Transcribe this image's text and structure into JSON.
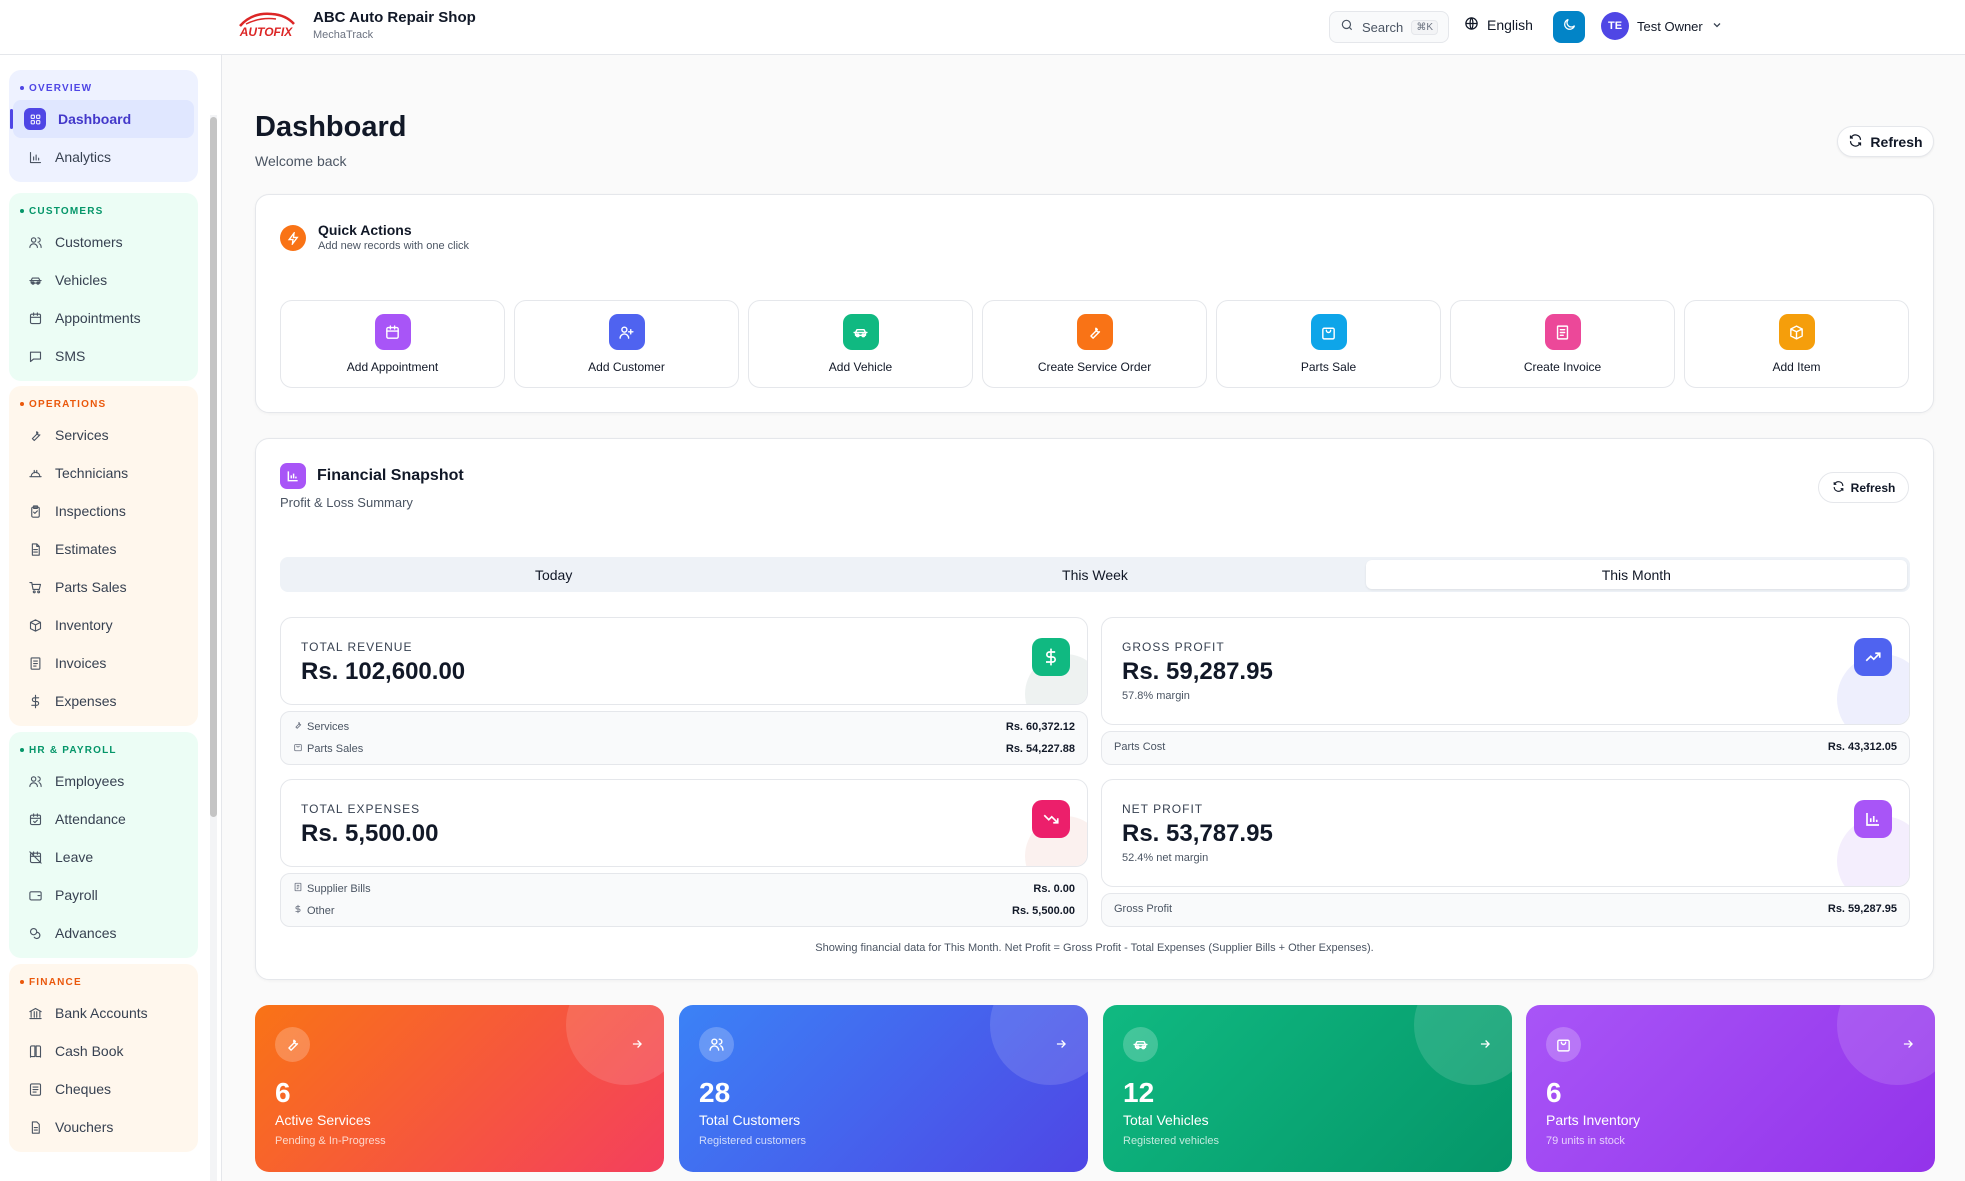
{
  "header": {
    "brand_title": "ABC Auto Repair Shop",
    "brand_sub": "MechaTrack",
    "logo_text": "AUTOFIX",
    "search_label": "Search",
    "search_kbd": "⌘K",
    "language": "English",
    "user_initials": "TE",
    "user_name": "Test Owner"
  },
  "sidebar": {
    "groups": [
      {
        "title": "OVERVIEW",
        "color": "#4f46e5",
        "bg": "#eef2ff",
        "items": [
          {
            "label": "Dashboard",
            "icon": "grid-icon"
          },
          {
            "label": "Analytics",
            "icon": "bar-chart-icon"
          }
        ]
      },
      {
        "title": "CUSTOMERS",
        "color": "#059669",
        "bg": "#ecfdf5",
        "items": [
          {
            "label": "Customers",
            "icon": "users-icon"
          },
          {
            "label": "Vehicles",
            "icon": "car-icon"
          },
          {
            "label": "Appointments",
            "icon": "calendar-icon"
          },
          {
            "label": "SMS",
            "icon": "message-icon"
          }
        ]
      },
      {
        "title": "OPERATIONS",
        "color": "#ea580c",
        "bg": "#fff7ed",
        "items": [
          {
            "label": "Services",
            "icon": "wrench-icon"
          },
          {
            "label": "Technicians",
            "icon": "hard-hat-icon"
          },
          {
            "label": "Inspections",
            "icon": "clipboard-icon"
          },
          {
            "label": "Estimates",
            "icon": "file-icon"
          },
          {
            "label": "Parts Sales",
            "icon": "cart-icon"
          },
          {
            "label": "Inventory",
            "icon": "package-icon"
          },
          {
            "label": "Invoices",
            "icon": "receipt-icon"
          },
          {
            "label": "Expenses",
            "icon": "dollar-icon"
          }
        ]
      },
      {
        "title": "HR & PAYROLL",
        "color": "#059669",
        "bg": "#ecfdf5",
        "items": [
          {
            "label": "Employees",
            "icon": "users-icon"
          },
          {
            "label": "Attendance",
            "icon": "calendar-check-icon"
          },
          {
            "label": "Leave",
            "icon": "calendar-off-icon"
          },
          {
            "label": "Payroll",
            "icon": "wallet-icon"
          },
          {
            "label": "Advances",
            "icon": "coins-icon"
          }
        ]
      },
      {
        "title": "FINANCE",
        "color": "#ea580c",
        "bg": "#fff7ed",
        "items": [
          {
            "label": "Bank Accounts",
            "icon": "bank-icon"
          },
          {
            "label": "Cash Book",
            "icon": "book-icon"
          },
          {
            "label": "Cheques",
            "icon": "cheque-icon"
          },
          {
            "label": "Vouchers",
            "icon": "voucher-icon"
          }
        ]
      }
    ]
  },
  "page": {
    "title": "Dashboard",
    "subtitle": "Welcome back",
    "refresh_label": "Refresh"
  },
  "quick_actions": {
    "title": "Quick Actions",
    "subtitle": "Add new records with one click",
    "items": [
      {
        "label": "Add Appointment",
        "color": "#a855f7",
        "icon": "calendar-icon"
      },
      {
        "label": "Add Customer",
        "color": "#4f63f0",
        "icon": "user-plus-icon"
      },
      {
        "label": "Add Vehicle",
        "color": "#10b981",
        "icon": "car-icon"
      },
      {
        "label": "Create Service Order",
        "color": "#f97316",
        "icon": "wrench-icon"
      },
      {
        "label": "Parts Sale",
        "color": "#0ea5e9",
        "icon": "bag-icon"
      },
      {
        "label": "Create Invoice",
        "color": "#ec4899",
        "icon": "receipt-icon"
      },
      {
        "label": "Add Item",
        "color": "#f59e0b",
        "icon": "package-icon"
      }
    ]
  },
  "financial": {
    "title": "Financial Snapshot",
    "subtitle": "Profit & Loss Summary",
    "refresh_label": "Refresh",
    "tabs": [
      "Today",
      "This Week",
      "This Month"
    ],
    "selected_tab": "This Month",
    "revenue": {
      "label": "TOTAL REVENUE",
      "value": "Rs. 102,600.00",
      "rows": [
        {
          "k": "Services",
          "v": "Rs. 60,372.12"
        },
        {
          "k": "Parts Sales",
          "v": "Rs. 54,227.88"
        }
      ]
    },
    "gross": {
      "label": "GROSS PROFIT",
      "value": "Rs. 59,287.95",
      "note": "57.8% margin",
      "row_k": "Parts Cost",
      "row_v": "Rs. 43,312.05"
    },
    "expenses": {
      "label": "TOTAL EXPENSES",
      "value": "Rs. 5,500.00",
      "rows": [
        {
          "k": "Supplier Bills",
          "v": "Rs. 0.00"
        },
        {
          "k": "Other",
          "v": "Rs. 5,500.00"
        }
      ]
    },
    "net": {
      "label": "NET PROFIT",
      "value": "Rs. 53,787.95",
      "note": "52.4% net margin",
      "row_k": "Gross Profit",
      "row_v": "Rs. 59,287.95"
    },
    "footer": "Showing financial data for This Month. Net Profit = Gross Profit - Total Expenses (Supplier Bills + Other Expenses)."
  },
  "summary_cards": [
    {
      "number": "6",
      "title": "Active Services",
      "sub": "Pending & In-Progress",
      "icon": "wrench-icon",
      "from": "#f97316",
      "to": "#f43f5e"
    },
    {
      "number": "28",
      "title": "Total Customers",
      "sub": "Registered customers",
      "icon": "users-icon",
      "from": "#3b82f6",
      "to": "#4f46e5"
    },
    {
      "number": "12",
      "title": "Total Vehicles",
      "sub": "Registered vehicles",
      "icon": "car-icon",
      "from": "#10b981",
      "to": "#059669"
    },
    {
      "number": "6",
      "title": "Parts Inventory",
      "sub": "79 units in stock",
      "icon": "bag-icon",
      "from": "#a855f7",
      "to": "#9333ea"
    }
  ]
}
